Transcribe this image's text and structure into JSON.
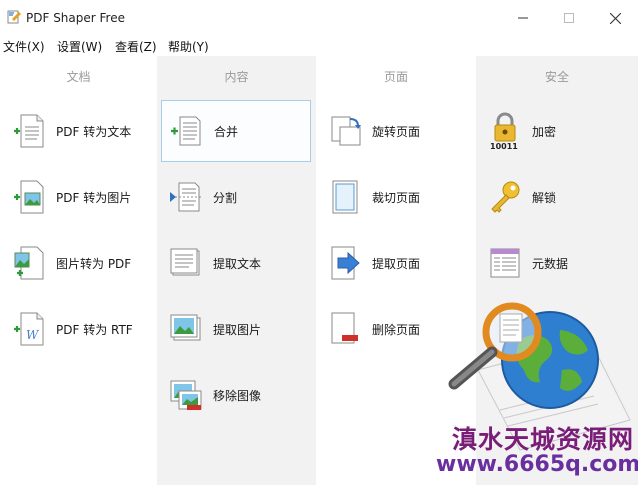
{
  "window": {
    "title": "PDF Shaper Free"
  },
  "menu": [
    "文件(X)",
    "设置(W)",
    "查看(Z)",
    "帮助(Y)"
  ],
  "columns": [
    {
      "header": "文档",
      "items": [
        {
          "label": "PDF 转为文本",
          "icon": "pdf-to-text-icon"
        },
        {
          "label": "PDF 转为图片",
          "icon": "pdf-to-image-icon"
        },
        {
          "label": "图片转为 PDF",
          "icon": "image-to-pdf-icon"
        },
        {
          "label": "PDF 转为 RTF",
          "icon": "pdf-to-rtf-icon"
        }
      ]
    },
    {
      "header": "内容",
      "items": [
        {
          "label": "合并",
          "icon": "merge-icon"
        },
        {
          "label": "分割",
          "icon": "split-icon"
        },
        {
          "label": "提取文本",
          "icon": "extract-text-icon"
        },
        {
          "label": "提取图片",
          "icon": "extract-images-icon"
        },
        {
          "label": "移除图像",
          "icon": "remove-images-icon"
        }
      ]
    },
    {
      "header": "页面",
      "items": [
        {
          "label": "旋转页面",
          "icon": "rotate-pages-icon"
        },
        {
          "label": "裁切页面",
          "icon": "crop-pages-icon"
        },
        {
          "label": "提取页面",
          "icon": "extract-pages-icon"
        },
        {
          "label": "删除页面",
          "icon": "delete-pages-icon"
        }
      ]
    },
    {
      "header": "安全",
      "items": [
        {
          "label": "加密",
          "icon": "encrypt-lock-icon"
        },
        {
          "label": "解锁",
          "icon": "unlock-key-icon"
        },
        {
          "label": "元数据",
          "icon": "metadata-icon"
        }
      ]
    }
  ],
  "watermark": {
    "line1": "滇水天城资源网",
    "line2": "www.6665q.com"
  }
}
